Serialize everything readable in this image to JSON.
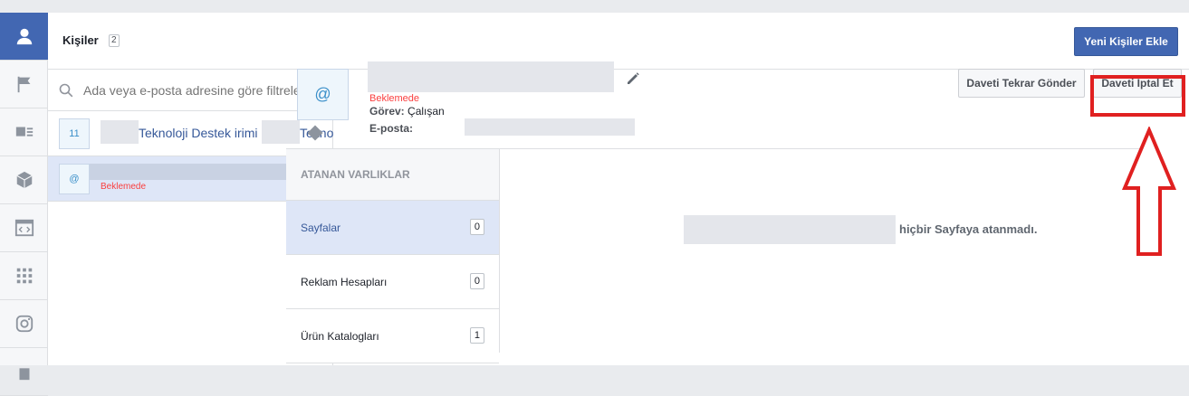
{
  "header": {
    "title": "Kişiler",
    "count": "2",
    "add_people_label": "Yeni Kişiler Ekle"
  },
  "search": {
    "placeholder": "Ada veya e-posta adresine göre filtrele..."
  },
  "people": [
    {
      "icon_text": "11",
      "name_part": "Teknoloji Destek irimi",
      "name_part2": "Tekno"
    },
    {
      "icon_text": "@",
      "status": "Beklemede"
    }
  ],
  "detail": {
    "avatar": "@",
    "status": "Beklemede",
    "role_label": "Görev:",
    "role_value": "Çalışan",
    "email_label": "E-posta:",
    "resend_label": "Daveti Tekrar Gönder",
    "cancel_label": "Daveti İptal Et"
  },
  "assets": {
    "title": "ATANAN VARLIKLAR",
    "items": [
      {
        "label": "Sayfalar",
        "count": "0"
      },
      {
        "label": "Reklam Hesapları",
        "count": "0"
      },
      {
        "label": "Ürün Katalogları",
        "count": "1"
      }
    ]
  },
  "empty_message": "hiçbir Sayfaya atanmadı.",
  "colors": {
    "accent": "#4267b2",
    "highlight": "#e02020",
    "pending": "#fa3e3e"
  }
}
